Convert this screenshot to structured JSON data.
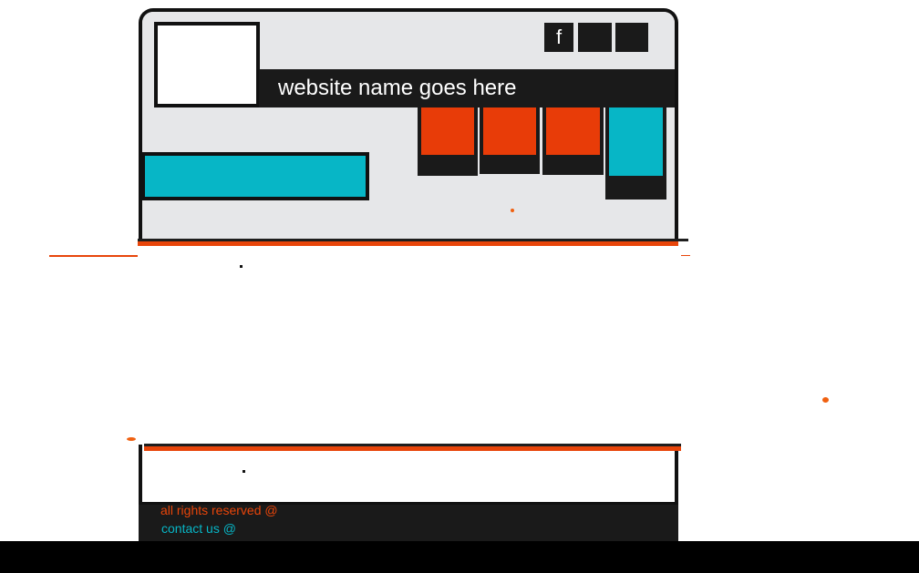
{
  "header": {
    "site_name": "website name goes here"
  },
  "social": {
    "facebook_label": "f"
  },
  "footer": {
    "rights": "all rights reserved @",
    "contact": "contact us @"
  },
  "colors": {
    "accent_orange": "#e8450a",
    "accent_cyan": "#07b6c6",
    "dark": "#1a1a1a",
    "header_bg": "#e6e7e9"
  },
  "icons": {
    "facebook": "facebook-icon"
  }
}
